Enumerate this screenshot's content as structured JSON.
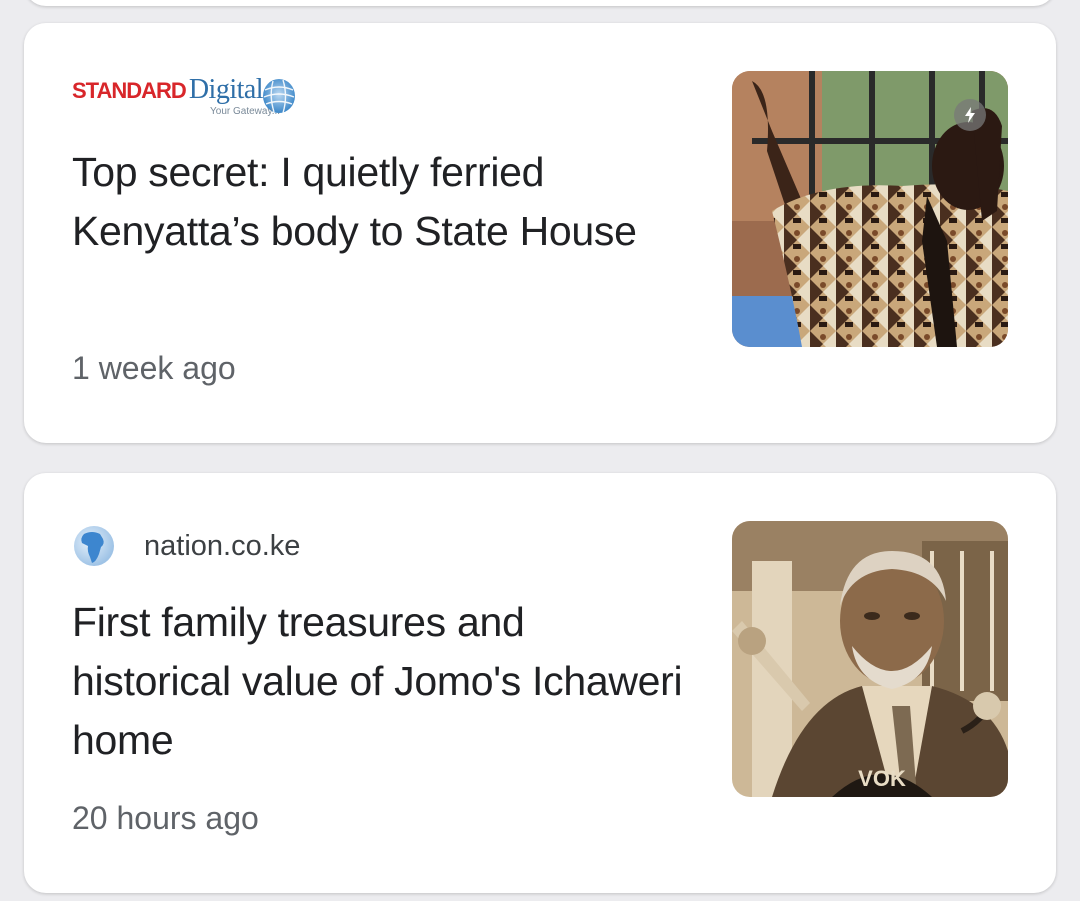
{
  "articles": [
    {
      "source": {
        "brand_word": "STANDARD",
        "brand_suffix": "Digital",
        "tagline": "Your Gateway...",
        "logo_icon": "standard-digital-globe-logo"
      },
      "headline": "Top secret: I quietly ferried Kenyatta’s body to State House",
      "time": "1 week ago",
      "thumbnail": {
        "icon": "photo-man-patterned-shirt",
        "badge_icon": "amp-lightning-icon"
      }
    },
    {
      "source": {
        "name": "nation.co.ke",
        "logo_icon": "africa-globe-icon"
      },
      "headline": "First family treasures and historical value of Jomo's Ichaweri home",
      "time": "20 hours ago",
      "thumbnail": {
        "icon": "photo-jomo-kenyatta-sepia",
        "mic_text": "VOK"
      }
    }
  ],
  "colors": {
    "background": "#ececef",
    "card": "#ffffff",
    "headline": "#202124",
    "meta": "#5f6368",
    "standard_red": "#d8262a",
    "standard_blue": "#2f6fa8"
  }
}
